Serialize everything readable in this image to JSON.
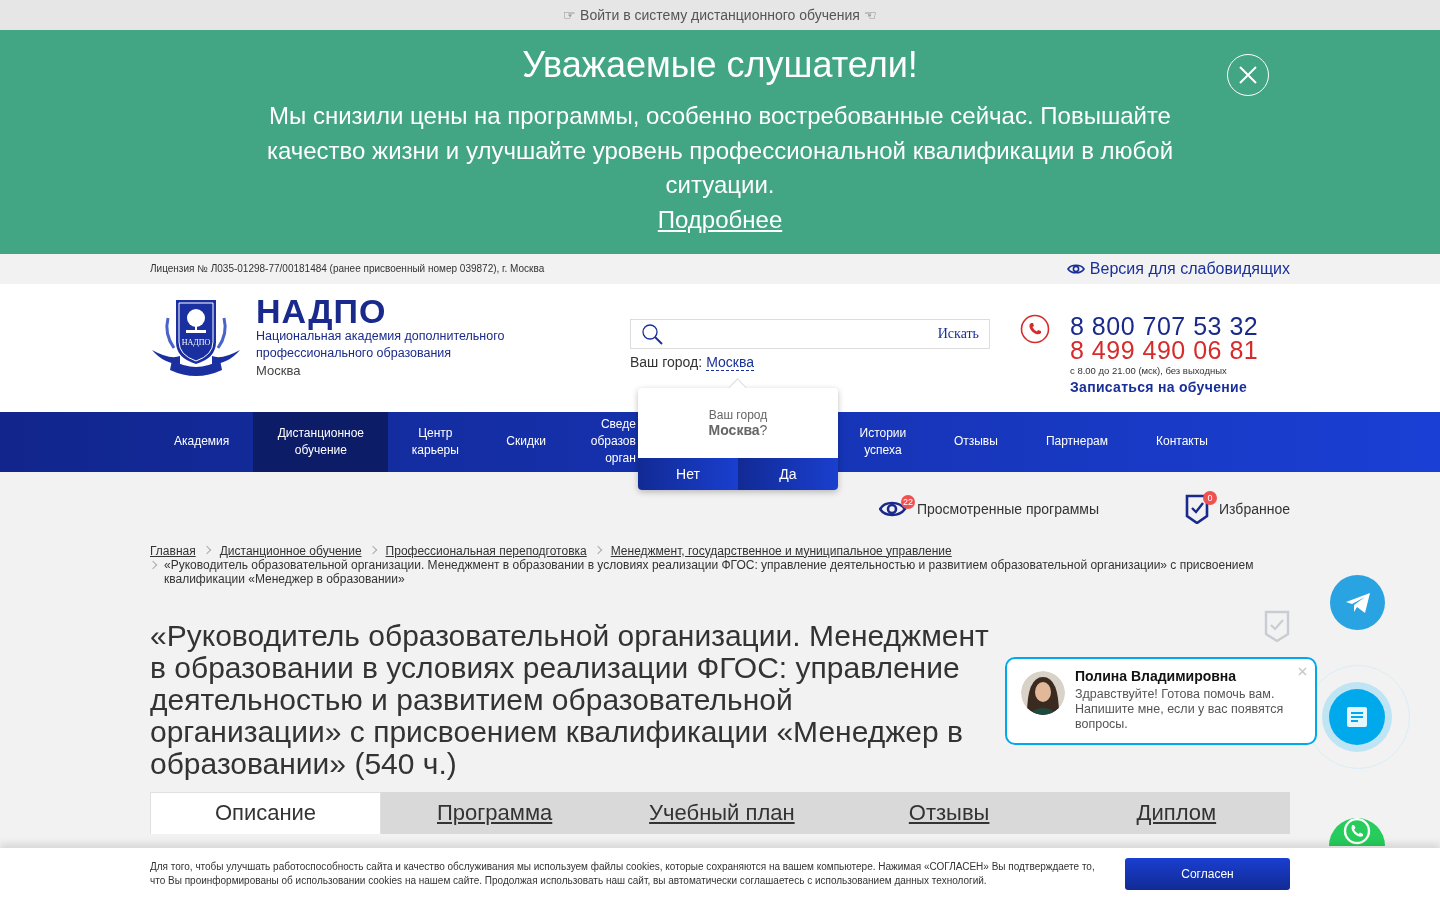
{
  "top_link": "☞ Войти в систему дистанционного обучения ☜",
  "banner": {
    "title": "Уважаемые слушатели!",
    "text": "Мы снизили цены на программы, особенно востребованные сейчас. Повышайте качество жизни и улучшайте уровень профессиональной квалификации в любой ситуации.",
    "link": "Подробнее"
  },
  "license": "Лицензия № Л035-01298-77/00181484 (ранее присвоенный номер 039872), г. Москва",
  "low_vision_link": "Версия для слабовидящих",
  "logo": {
    "name": "НАДПО",
    "emblem_text": "НАДПО",
    "subtitle": "Национальная академия дополнительного профессионального образования",
    "city": "Москва"
  },
  "search": {
    "button": "Искать"
  },
  "city": {
    "label": "Ваш город:",
    "value": "Москва"
  },
  "city_popup": {
    "question": "Ваш город",
    "answer": "**Москва**?",
    "buttons": [
      "Нет",
      "Да"
    ]
  },
  "contacts": {
    "phones": [
      {
        "number": "8 800 707 53 32",
        "color": "#1a2a8c"
      },
      {
        "number": "8 499 490 06 81",
        "color": "#d62b2b"
      }
    ],
    "hours": "с 8.00 до 21.00 (мск), без выходных",
    "signup": "Записаться на обучение"
  },
  "nav": [
    {
      "label": "Академия",
      "selected": false
    },
    {
      "label": "Дистанционное обучение",
      "selected": true
    },
    {
      "label": "Центр карьеры",
      "selected": false
    },
    {
      "label": "Скидки",
      "selected": false
    },
    {
      "label": "Сведе\nобразов\nорган",
      "selected": false,
      "kind": "covered"
    },
    {
      "label": "Истории успеха",
      "selected": false
    },
    {
      "label": "Отзывы",
      "selected": false
    },
    {
      "label": "Партнерам",
      "selected": false
    },
    {
      "label": "Контакты",
      "selected": false
    }
  ],
  "widgets": [
    {
      "kind": "viewed",
      "label": "Просмотренные программы",
      "count": "22"
    },
    {
      "kind": "favorites",
      "label": "Избранное",
      "count": "0"
    }
  ],
  "breadcrumbs": [
    "Главная",
    "Дистанционное обучение",
    "Профессиональная переподготовка",
    "Менеджмент, государственное и муниципальное управление"
  ],
  "breadcrumb_current": "«Руководитель образовательной организации. Менеджмент в образовании в условиях реализации ФГОС: управление деятельностью и развитием образовательной организации» с присвоением квалификации «Менеджер в образовании»",
  "title": "«Руководитель образовательной организации. Менеджмент в образовании в условиях реализации ФГОС: управление деятельностью и развитием образовательной организации» с присвоением квалификации «Менеджер в образовании» (540 ч.)",
  "tabs": [
    {
      "label": "Описание",
      "selected": true
    },
    {
      "label": "Программа",
      "selected": false
    },
    {
      "label": "Учебный план",
      "selected": false
    },
    {
      "label": "Отзывы",
      "selected": false
    },
    {
      "label": "Диплом",
      "selected": false
    }
  ],
  "chat": {
    "name": "Полина Владимировна",
    "message": "Здравствуйте! Готова помочь вам. Напишите мне, если у вас появятся вопросы."
  },
  "cookie": {
    "text": "Для того, чтобы улучшать работоспособность сайта и качество обслуживания мы используем файлы cookies, которые сохраняются на вашем компьютере. Нажимая «СОГЛАСЕН» Вы подтверждаете то, что Вы проинформированы об использовании cookies на нашем сайте. Продолжая использовать наш сайт, вы автоматически соглашаетесь с использованием данных технологий.",
    "button": "Согласен"
  }
}
